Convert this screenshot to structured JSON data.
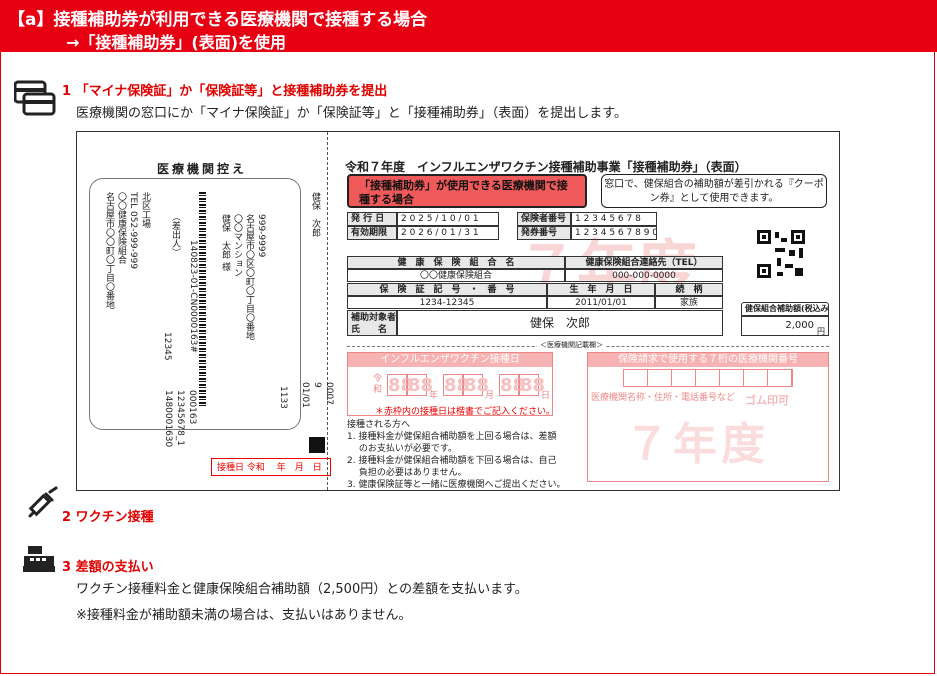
{
  "header": {
    "line1": "【a】接種補助券が利用できる医療機関で接種する場合",
    "line2": "→「接種補助券」(表面)を使用"
  },
  "steps": [
    {
      "title": "1 「マイナ保険証」か「保険証等」と接種補助券を提出",
      "desc": "医療機関の窓口にか「マイナ保険証」か「保険証等」と「接種補助券」（表面）を提出します。",
      "icon": "card-icon"
    },
    {
      "title": "2 ワクチン接種",
      "icon": "syringe-icon"
    },
    {
      "title": "3 差額の支払い",
      "desc1": "ワクチン接種料金と健康保険組合補助額（2,500円）との差額を支払います。",
      "desc2": "※接種料金が補助額未満の場合は、支払いはありません。",
      "icon": "register-icon"
    }
  ],
  "voucher": {
    "stub": {
      "title": "医療機関控え",
      "col1": "北区工場\nTEL 052-999-999\n〇〇健康保険組合\n名古屋市〇〇町〇丁目〇番地",
      "col2": "（差出人）",
      "col3": "999-9999\n名古屋市〇区〇町〇丁目〇番地\n〇〇マンション\n健保　太郎 様",
      "col4": "140823-01-CN0000163#",
      "col5": "12345",
      "col6": "健保　次郎",
      "col7": "1133",
      "col8": "0007\n9\n01/01",
      "col9": "000163\n12345678_1\n1480001630",
      "date_label": "接種日 令和　 年　月　日"
    },
    "title": "令和７年度　インフルエンザワクチン接種補助事業「接種補助券」（表面）",
    "redbox": "「接種補助券」が使用できる医療機関で接種する場合",
    "note": "窓口で、健保組合の補助額が差引かれる『クーポン券』として使用できます。",
    "issue_label": "発 行 日",
    "issue_value": "2 0 2 5 / 1 0 / 0 1",
    "valid_label": "有効期限",
    "valid_value": "2 0 2 6 / 0 1 / 3 1",
    "insurer_label": "保険者番号",
    "insurer_value": "1 2 3 4 5 6 7 8",
    "ticket_label": "発券番号",
    "ticket_value": "1 2 3 4 5 6 7 8 9 0",
    "union_label": "健　康　保　険　組　合　名",
    "union_value": "〇〇健康保険組合",
    "tel_label": "健康保険組合連絡先（TEL）",
    "tel_value": "000-000-0000",
    "cert_label": "保　険　証　記　号　・　番　号",
    "cert_value": "1234-12345",
    "birth_label": "生　年　月　日",
    "birth_value": "2011/01/01",
    "rel_label": "続　柄",
    "rel_value": "家族",
    "person_label": "補助対象者\n氏　　名",
    "person_value": "健保　次郎",
    "amount_label": "健保組合補助額(税込み)",
    "amount_value": "2,000",
    "amount_unit": "円",
    "watermark": "７年度",
    "divider": "＜医療機関記載欄＞",
    "vacc_header": "インフルエンザワクチン接種日",
    "era": "令\n和",
    "digit": "88",
    "y": "年",
    "m": "月",
    "d": "日",
    "vacc_note": "＊赤枠内の接種日は楷書でご記入ください。",
    "clinic_header": "保険請求で使用する７桁の医療機関番号",
    "clinic_info": "医療機関名称・住所・電話番号など",
    "stamp": "ゴム印可",
    "instructions": "接種される方へ\n1. 接種料金が健保組合補助額を上回る場合は、差額\n　 のお支払いが必要です。\n2. 接種料金が健保組合補助額を下回る場合は、自己\n　 負担の必要はありません。\n3. 健康保険証等と一緒に医療機関へご提出ください。"
  }
}
